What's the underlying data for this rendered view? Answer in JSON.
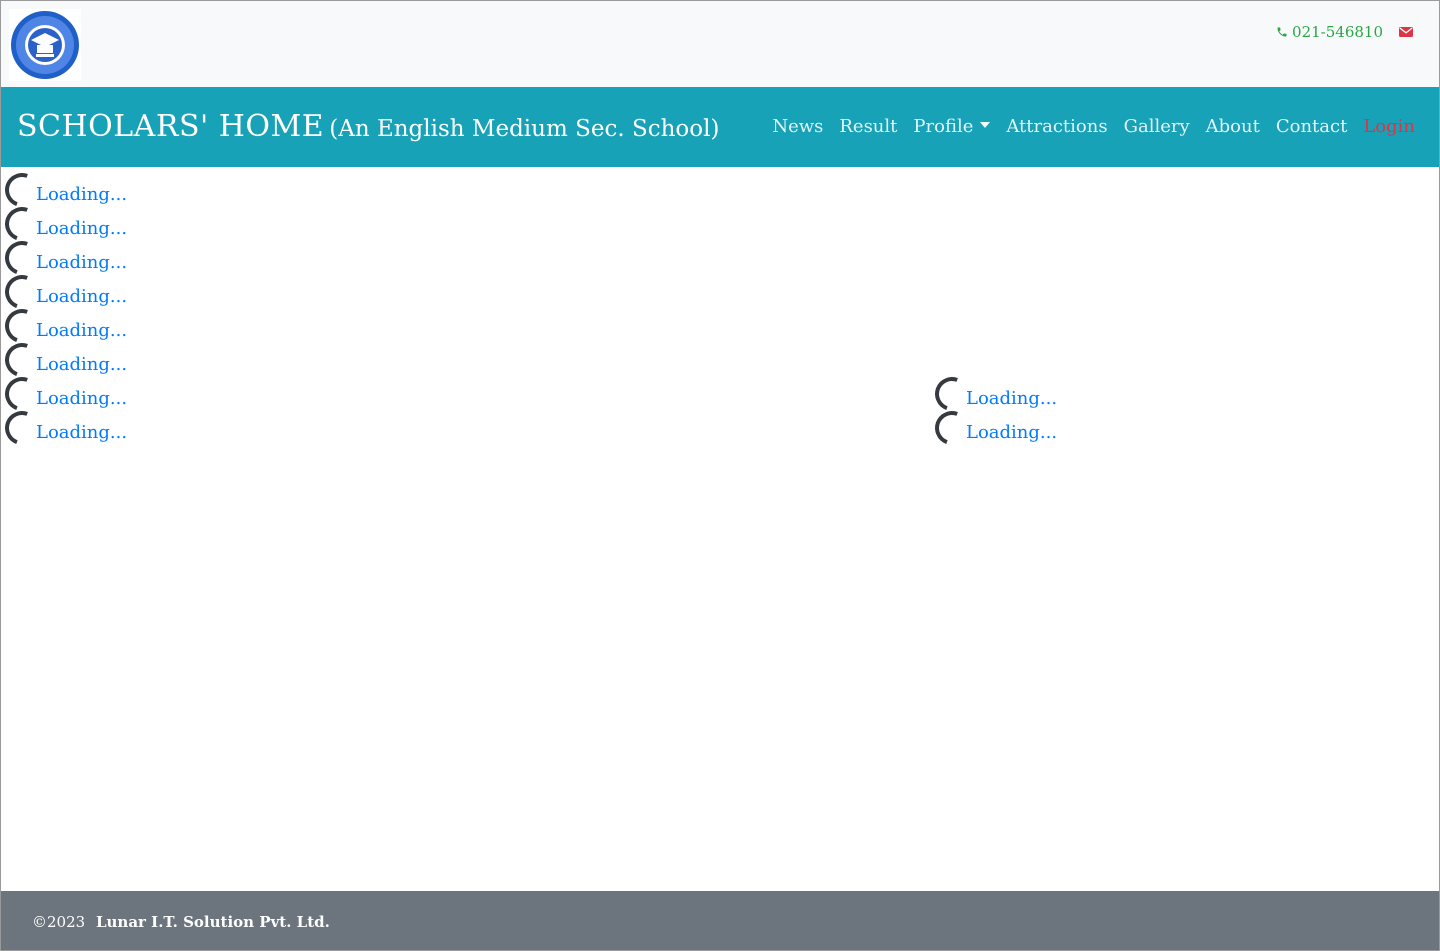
{
  "header": {
    "phone_label": "021-546810",
    "logo_icon": "school-emblem-logo"
  },
  "navbar": {
    "brand_main": "SCHOLARS' HOME",
    "brand_sub": "(An English Medium Sec. School)",
    "items": [
      {
        "label": "News"
      },
      {
        "label": "Result"
      },
      {
        "label": "Profile"
      },
      {
        "label": "Attractions"
      },
      {
        "label": "Gallery"
      },
      {
        "label": "About"
      },
      {
        "label": "Contact"
      },
      {
        "label": "Login"
      }
    ]
  },
  "loading": {
    "text": "Loading..."
  },
  "footer": {
    "copyright": "©2023",
    "company": "Lunar I.T. Solution Pvt. Ltd."
  },
  "colors": {
    "navbar_bg": "#17a2b8",
    "topbar_bg": "#f8f9fa",
    "footer_bg": "#6c757d",
    "phone": "#28a745",
    "mail": "#dc3545",
    "login": "#dc3545",
    "loading_text": "#007bff"
  }
}
